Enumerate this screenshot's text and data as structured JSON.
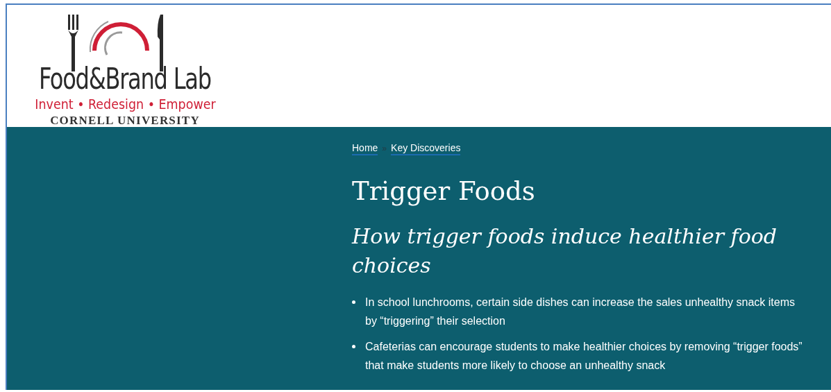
{
  "logo": {
    "name": "Food&Brand Lab",
    "tagline": "Invent • Redesign • Empower",
    "university": "CORNELL UNIVERSITY"
  },
  "breadcrumb": {
    "items": [
      {
        "label": "Home"
      },
      {
        "label": "Key Discoveries"
      }
    ],
    "separator": "»"
  },
  "title": "Trigger Foods",
  "subtitle": "How trigger foods induce healthier food choices",
  "bullets": [
    "In school lunchrooms, certain side dishes can increase the sales unhealthy snack items by “triggering” their selection",
    "Cafeterias can encourage students to make healthier choices by removing “trigger foods” that make students more likely to choose an unhealthy snack"
  ]
}
